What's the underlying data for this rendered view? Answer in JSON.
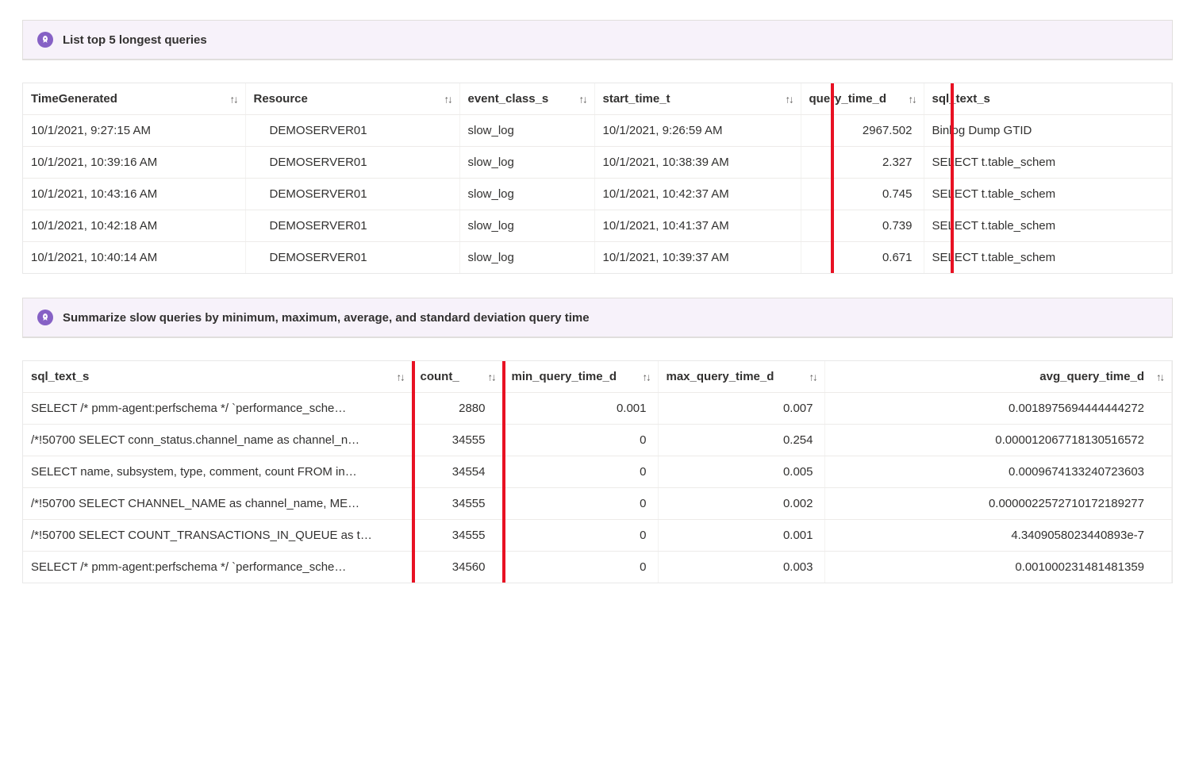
{
  "panel1": {
    "title": "List top 5 longest queries",
    "columns": {
      "c0": "TimeGenerated",
      "c1": "Resource",
      "c2": "event_class_s",
      "c3": "start_time_t",
      "c4": "query_time_d",
      "c5": "sql_text_s"
    },
    "rows": [
      {
        "time": "10/1/2021, 9:27:15 AM",
        "resource": "DEMOSERVER01",
        "event": "slow_log",
        "start": "10/1/2021, 9:26:59 AM",
        "qtime": "2967.502",
        "sql": "Binlog Dump GTID"
      },
      {
        "time": "10/1/2021, 10:39:16 AM",
        "resource": "DEMOSERVER01",
        "event": "slow_log",
        "start": "10/1/2021, 10:38:39 AM",
        "qtime": "2.327",
        "sql": "SELECT t.table_schem"
      },
      {
        "time": "10/1/2021, 10:43:16 AM",
        "resource": "DEMOSERVER01",
        "event": "slow_log",
        "start": "10/1/2021, 10:42:37 AM",
        "qtime": "0.745",
        "sql": "SELECT t.table_schem"
      },
      {
        "time": "10/1/2021, 10:42:18 AM",
        "resource": "DEMOSERVER01",
        "event": "slow_log",
        "start": "10/1/2021, 10:41:37 AM",
        "qtime": "0.739",
        "sql": "SELECT t.table_schem"
      },
      {
        "time": "10/1/2021, 10:40:14 AM",
        "resource": "DEMOSERVER01",
        "event": "slow_log",
        "start": "10/1/2021, 10:39:37 AM",
        "qtime": "0.671",
        "sql": "SELECT t.table_schem"
      }
    ]
  },
  "panel2": {
    "title": "Summarize slow queries by minimum, maximum, average, and standard deviation query time",
    "columns": {
      "c0": "sql_text_s",
      "c1": "count_",
      "c2": "min_query_time_d",
      "c3": "max_query_time_d",
      "c4": "avg_query_time_d"
    },
    "rows": [
      {
        "sql": "SELECT /* pmm-agent:perfschema */ `performance_sche…",
        "count": "2880",
        "min": "0.001",
        "max": "0.007",
        "avg": "0.0018975694444444272"
      },
      {
        "sql": "/*!50700 SELECT conn_status.channel_name as channel_n…",
        "count": "34555",
        "min": "0",
        "max": "0.254",
        "avg": "0.00001206771813051​6572"
      },
      {
        "sql": "SELECT name, subsystem, type, comment, count FROM in…",
        "count": "34554",
        "min": "0",
        "max": "0.005",
        "avg": "0.0009674133240723603"
      },
      {
        "sql": "/*!50700 SELECT CHANNEL_NAME as channel_name, ME…",
        "count": "34555",
        "min": "0",
        "max": "0.002",
        "avg": "0.000002257271017218​9277"
      },
      {
        "sql": "/*!50700 SELECT COUNT_TRANSACTIONS_IN_QUEUE as t…",
        "count": "34555",
        "min": "0",
        "max": "0.001",
        "avg": "4.3409058023440893e-7"
      },
      {
        "sql": "SELECT /* pmm-agent:perfschema */ `performance_sche…",
        "count": "34560",
        "min": "0",
        "max": "0.003",
        "avg": "0.001000231481481359"
      }
    ]
  }
}
